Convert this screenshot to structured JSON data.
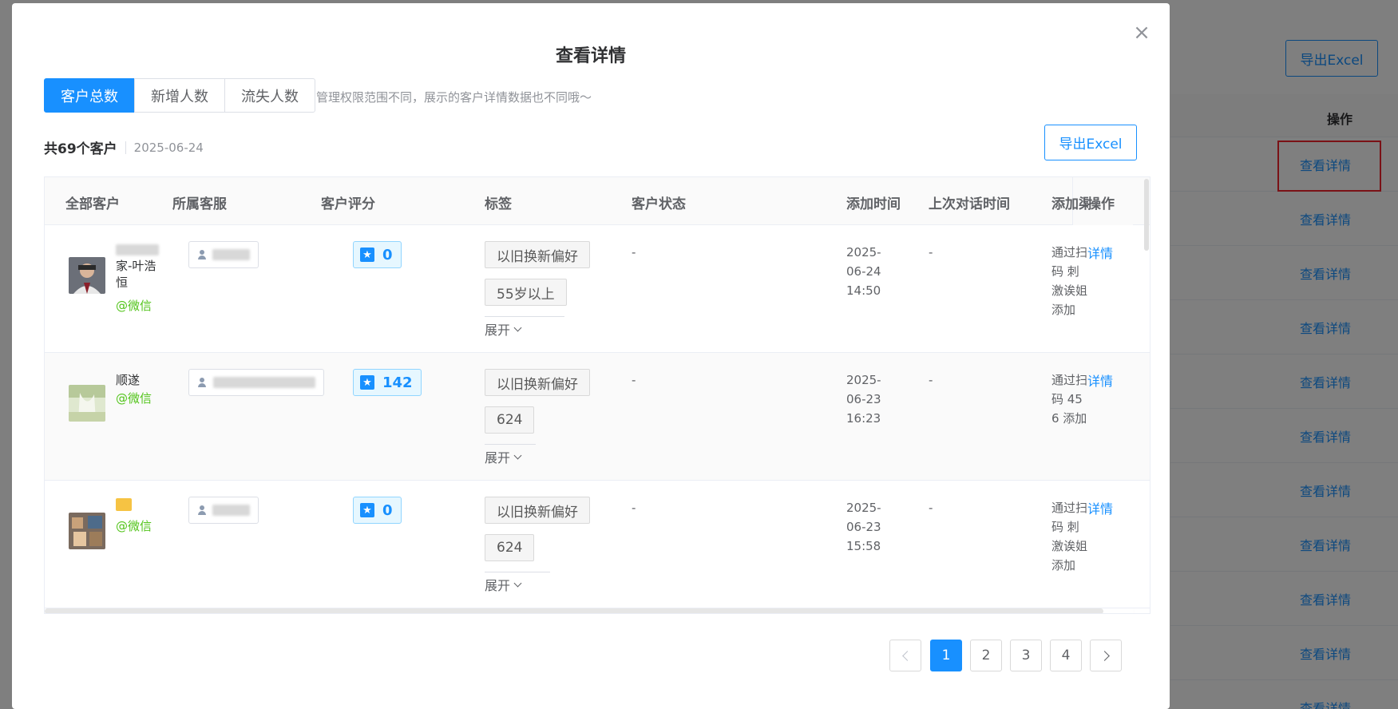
{
  "background": {
    "export_label": "导出Excel",
    "op_header": "操作",
    "row_link": "查看详情",
    "rows": 11
  },
  "dialog": {
    "title": "查看详情",
    "close_icon": "close-icon",
    "tabs": [
      {
        "label": "客户总数",
        "active": true
      },
      {
        "label": "新增人数",
        "active": false
      },
      {
        "label": "流失人数",
        "active": false
      }
    ],
    "note": "管理权限范围不同，展示的客户详情数据也不同哦～",
    "summary_count": "共69个客户",
    "summary_date": "2025-06-24",
    "export_label": "导出Excel"
  },
  "table": {
    "headers": [
      "全部客户",
      "所属客服",
      "客户评分",
      "标签",
      "客户状态",
      "添加时间",
      "上次对话时间",
      "添加渠",
      "操作"
    ],
    "rows": [
      {
        "name": "家-叶浩恒",
        "source": "@微信",
        "score": "0",
        "tags": [
          "以旧换新偏好",
          "55岁以上"
        ],
        "expand": "展开",
        "status": "-",
        "add_time": "2025-06-24 14:50",
        "last_chat": "-",
        "channel": "通过扫码 刺激诶姐 添加",
        "action": "详情"
      },
      {
        "name": "顺遂",
        "source": "@微信",
        "score": "142",
        "tags": [
          "以旧换新偏好",
          "624"
        ],
        "expand": "展开",
        "status": "-",
        "add_time": "2025-06-23 16:23",
        "last_chat": "-",
        "channel": "通过扫码 456 添加",
        "action": "详情"
      },
      {
        "name": "",
        "source": "@微信",
        "score": "0",
        "tags": [
          "以旧换新偏好",
          "624"
        ],
        "expand": "展开",
        "status": "-",
        "add_time": "2025-06-23 15:58",
        "last_chat": "-",
        "channel": "通过扫码 刺激诶姐 添加",
        "action": "详情"
      }
    ]
  },
  "pagination": {
    "pages": [
      "1",
      "2",
      "3",
      "4"
    ],
    "current": "1"
  },
  "colors": {
    "primary": "#1890ff",
    "wechat": "#52c41a",
    "highlight": "#f5222d"
  }
}
